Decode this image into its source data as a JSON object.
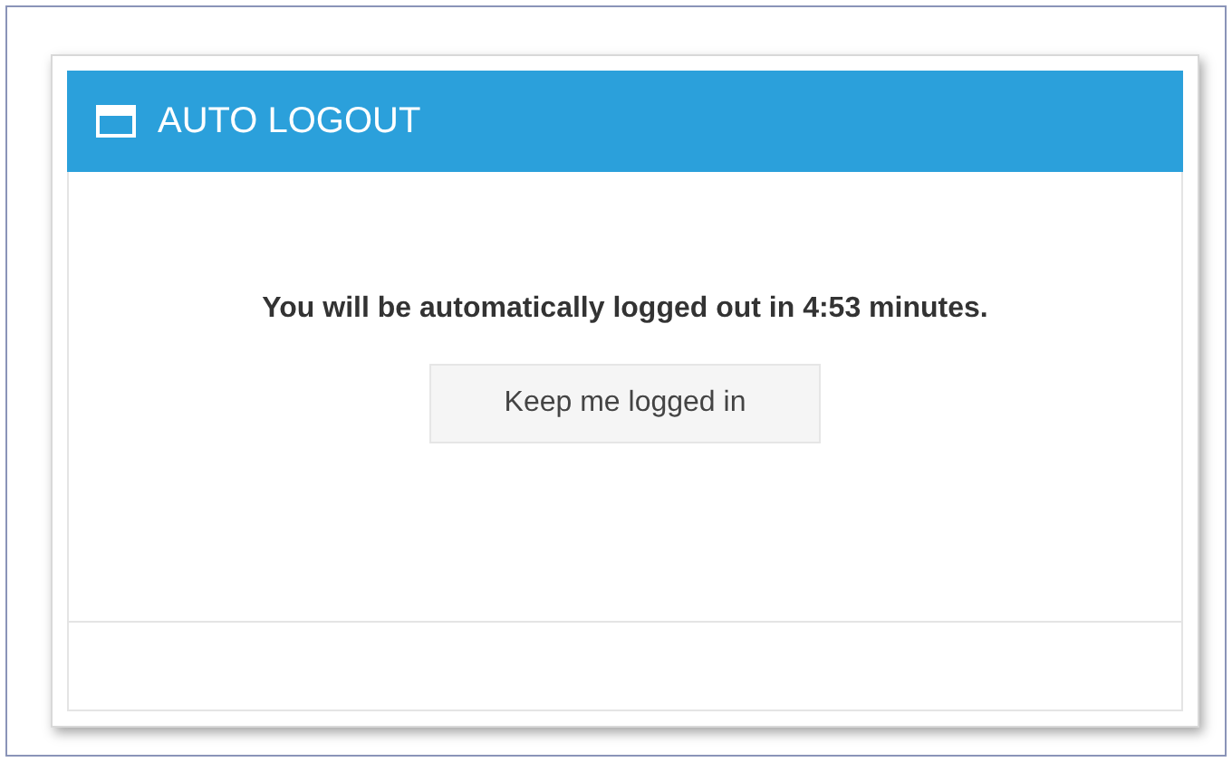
{
  "dialog": {
    "title": "AUTO LOGOUT",
    "message": "You will be automatically logged out in 4:53 minutes.",
    "button": "Keep me logged in"
  }
}
